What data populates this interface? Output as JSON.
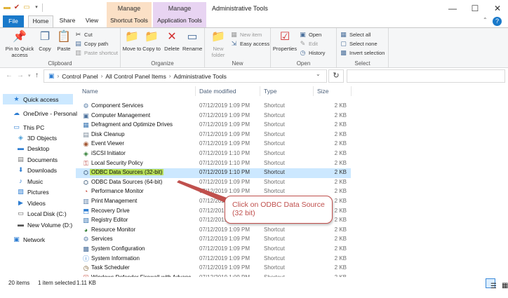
{
  "window": {
    "title": "Administrative Tools",
    "contextual": [
      {
        "label": "Manage",
        "color": "#fbe0c6"
      },
      {
        "label": "Manage",
        "color": "#e8d4f2"
      }
    ],
    "controls": {
      "minimize": "—",
      "maximize": "☐",
      "close": "✕"
    }
  },
  "tabs": {
    "file": "File",
    "home": "Home",
    "share": "Share",
    "view": "View",
    "shortcut_tools": "Shortcut Tools",
    "application_tools": "Application Tools"
  },
  "ribbon": {
    "clipboard": {
      "label": "Clipboard",
      "pin": "Pin to Quick access",
      "copy": "Copy",
      "paste": "Paste",
      "cut": "Cut",
      "copy_path": "Copy path",
      "paste_shortcut": "Paste shortcut"
    },
    "organize": {
      "label": "Organize",
      "move_to": "Move to",
      "copy_to": "Copy to",
      "delete": "Delete",
      "rename": "Rename"
    },
    "new": {
      "label": "New",
      "new_folder": "New folder",
      "new_item": "New item",
      "easy_access": "Easy access"
    },
    "open": {
      "label": "Open",
      "properties": "Properties",
      "open": "Open",
      "edit": "Edit",
      "history": "History"
    },
    "select": {
      "label": "Select",
      "select_all": "Select all",
      "select_none": "Select none",
      "invert_selection": "Invert selection"
    }
  },
  "address": {
    "crumbs": [
      "Control Panel",
      "All Control Panel Items",
      "Administrative Tools"
    ],
    "search_placeholder": ""
  },
  "nav": {
    "quick_access": "Quick access",
    "onedrive": "OneDrive - Personal",
    "this_pc": "This PC",
    "objects3d": "3D Objects",
    "desktop": "Desktop",
    "documents": "Documents",
    "downloads": "Downloads",
    "music": "Music",
    "pictures": "Pictures",
    "videos": "Videos",
    "local_disk": "Local Disk (C:)",
    "new_volume": "New Volume (D:)",
    "network": "Network"
  },
  "columns": {
    "name": "Name",
    "date": "Date modified",
    "type": "Type",
    "size": "Size"
  },
  "files": [
    {
      "name": "Component Services",
      "date": "07/12/2019 1:09 PM",
      "type": "Shortcut",
      "size": "2 KB"
    },
    {
      "name": "Computer Management",
      "date": "07/12/2019 1:09 PM",
      "type": "Shortcut",
      "size": "2 KB"
    },
    {
      "name": "Defragment and Optimize Drives",
      "date": "07/12/2019 1:09 PM",
      "type": "Shortcut",
      "size": "2 KB"
    },
    {
      "name": "Disk Cleanup",
      "date": "07/12/2019 1:09 PM",
      "type": "Shortcut",
      "size": "2 KB"
    },
    {
      "name": "Event Viewer",
      "date": "07/12/2019 1:09 PM",
      "type": "Shortcut",
      "size": "2 KB"
    },
    {
      "name": "iSCSI Initiator",
      "date": "07/12/2019 1:10 PM",
      "type": "Shortcut",
      "size": "2 KB"
    },
    {
      "name": "Local Security Policy",
      "date": "07/12/2019 1:10 PM",
      "type": "Shortcut",
      "size": "2 KB"
    },
    {
      "name": "ODBC Data Sources (32-bit)",
      "date": "07/12/2019 1:10 PM",
      "type": "Shortcut",
      "size": "2 KB"
    },
    {
      "name": "ODBC Data Sources (64-bit)",
      "date": "07/12/2019 1:09 PM",
      "type": "Shortcut",
      "size": "2 KB"
    },
    {
      "name": "Performance Monitor",
      "date": "07/12/2019 1:09 PM",
      "type": "Shortcut",
      "size": "2 KB"
    },
    {
      "name": "Print Management",
      "date": "07/12/2019 1:09 PM",
      "type": "Shortcut",
      "size": "2 KB"
    },
    {
      "name": "Recovery Drive",
      "date": "07/12/2019 1:09 PM",
      "type": "Shortcut",
      "size": "2 KB"
    },
    {
      "name": "Registry Editor",
      "date": "07/12/2019 1:09 PM",
      "type": "Shortcut",
      "size": "2 KB"
    },
    {
      "name": "Resource Monitor",
      "date": "07/12/2019 1:09 PM",
      "type": "Shortcut",
      "size": "2 KB"
    },
    {
      "name": "Services",
      "date": "07/12/2019 1:09 PM",
      "type": "Shortcut",
      "size": "2 KB"
    },
    {
      "name": "System Configuration",
      "date": "07/12/2019 1:09 PM",
      "type": "Shortcut",
      "size": "2 KB"
    },
    {
      "name": "System Information",
      "date": "07/12/2019 1:09 PM",
      "type": "Shortcut",
      "size": "2 KB"
    },
    {
      "name": "Task Scheduler",
      "date": "07/12/2019 1:09 PM",
      "type": "Shortcut",
      "size": "2 KB"
    },
    {
      "name": "Windows Defender Firewall with Advanc",
      "date": "07/12/2019 1:09 PM",
      "type": "Shortcut",
      "size": "2 KB"
    }
  ],
  "selected_index": 7,
  "callout": {
    "text": "Click on ODBC Data Source (32 bit)",
    "color": "#c0504d"
  },
  "status": {
    "items": "20 items",
    "selected": "1 item selected",
    "size": "1.11 KB"
  }
}
